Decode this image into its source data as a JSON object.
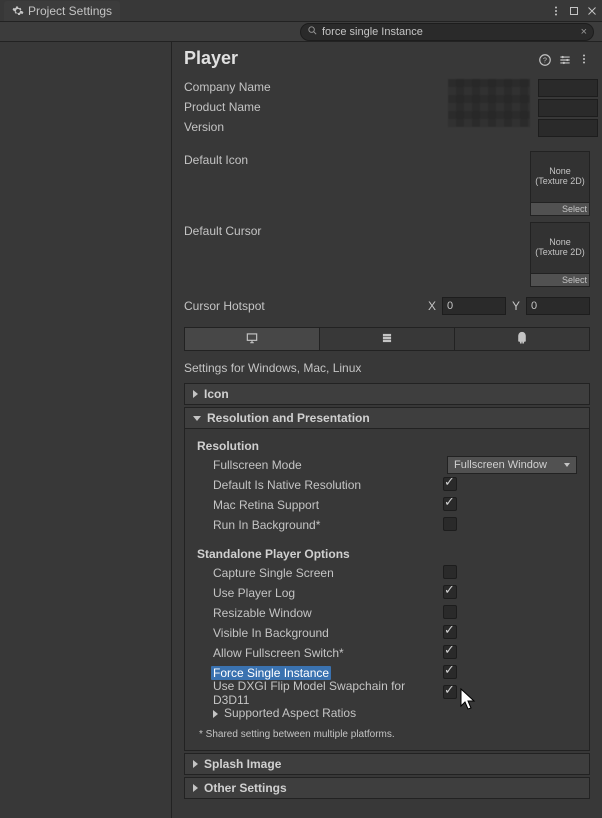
{
  "window": {
    "title": "Project Settings"
  },
  "search": {
    "query": "force single Instance"
  },
  "page": {
    "title": "Player"
  },
  "basic": {
    "company_label": "Company Name",
    "product_label": "Product Name",
    "version_label": "Version",
    "company_value": "",
    "product_value": "",
    "version_value": ""
  },
  "default_icon": {
    "label": "Default Icon",
    "slot_line1": "None",
    "slot_line2": "(Texture 2D)",
    "select": "Select"
  },
  "default_cursor": {
    "label": "Default Cursor",
    "slot_line1": "None",
    "slot_line2": "(Texture 2D)",
    "select": "Select"
  },
  "cursor_hotspot": {
    "label": "Cursor Hotspot",
    "x_label": "X",
    "x_value": "0",
    "y_label": "Y",
    "y_value": "0"
  },
  "platform_subtitle": "Settings for Windows, Mac, Linux",
  "foldouts": {
    "icon": "Icon",
    "res": "Resolution and Presentation",
    "splash": "Splash Image",
    "other": "Other Settings"
  },
  "res": {
    "heading1": "Resolution",
    "fullscreen_mode_label": "Fullscreen Mode",
    "fullscreen_mode_value": "Fullscreen Window",
    "default_native_label": "Default Is Native Resolution",
    "mac_retina_label": "Mac Retina Support",
    "run_bg_label": "Run In Background*",
    "heading2": "Standalone Player Options",
    "capture_single_label": "Capture Single Screen",
    "use_player_log_label": "Use Player Log",
    "resizable_label": "Resizable Window",
    "visible_bg_label": "Visible In Background",
    "allow_fs_switch_label": "Allow Fullscreen Switch*",
    "force_single_label": "Force Single Instance",
    "dxgi_label": "Use DXGI Flip Model Swapchain for D3D11",
    "supported_ar_label": "Supported Aspect Ratios",
    "footnote": "* Shared setting between multiple platforms."
  },
  "checks": {
    "default_native": true,
    "mac_retina": true,
    "run_bg": false,
    "capture_single": false,
    "use_player_log": true,
    "resizable": false,
    "visible_bg": true,
    "allow_fs_switch": true,
    "force_single": true,
    "dxgi": true
  }
}
